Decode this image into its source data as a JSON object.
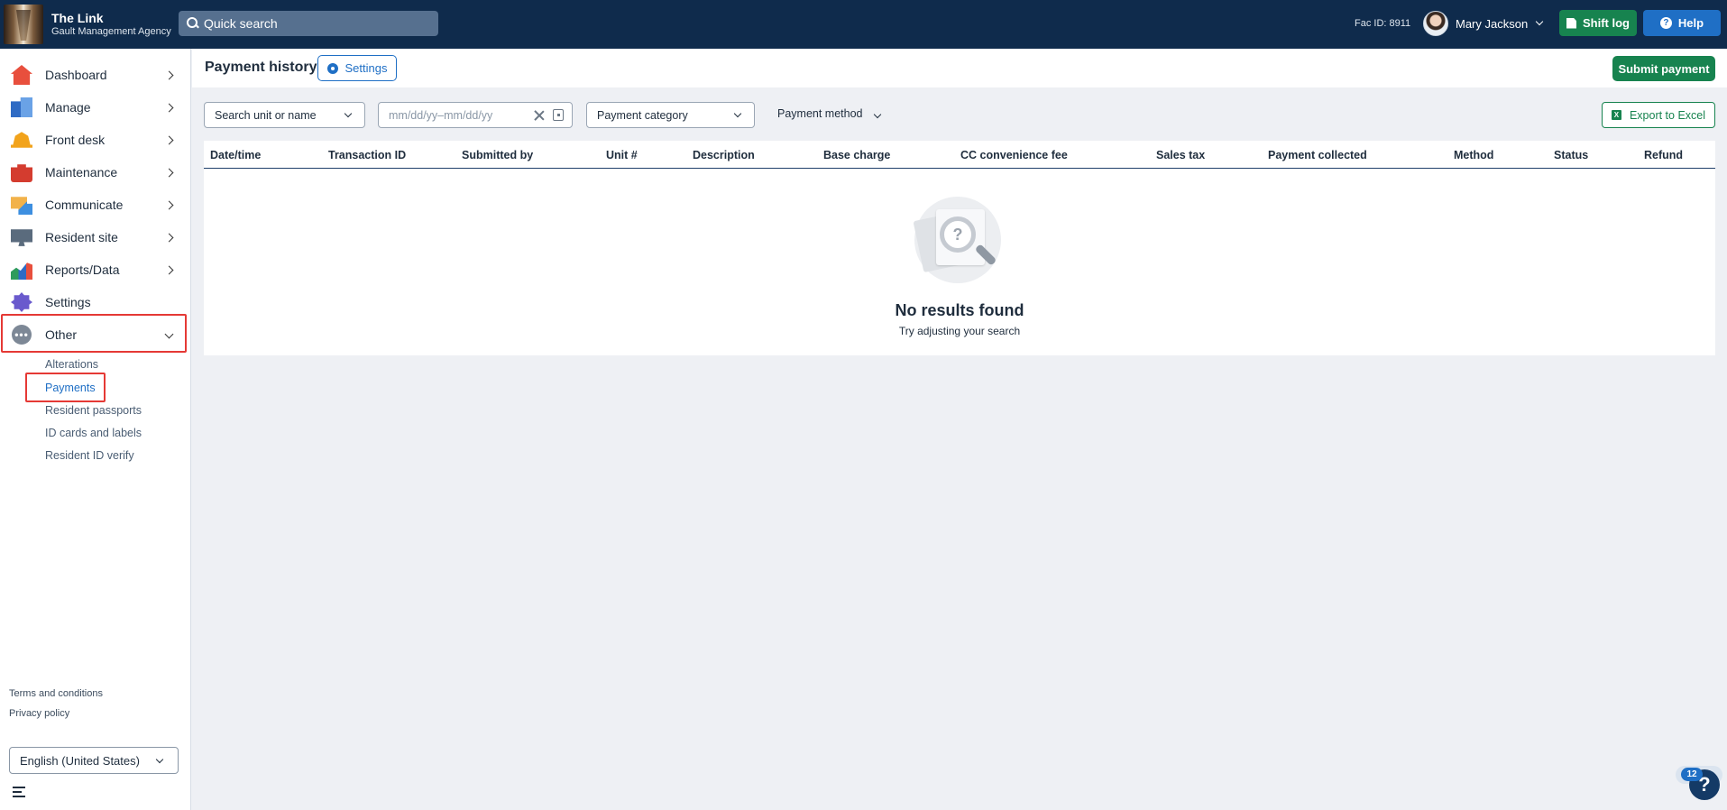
{
  "app": {
    "name": "The Link",
    "agency": "Gault Management Agency",
    "quick_search_label": "Quick search",
    "fac_id": "Fac ID: 8911",
    "user_name": "Mary Jackson",
    "shift_log_label": "Shift log",
    "help_label": "Help"
  },
  "sidebar": {
    "items": [
      {
        "label": "Dashboard"
      },
      {
        "label": "Manage"
      },
      {
        "label": "Front desk"
      },
      {
        "label": "Maintenance"
      },
      {
        "label": "Communicate"
      },
      {
        "label": "Resident site"
      },
      {
        "label": "Reports/Data"
      },
      {
        "label": "Settings"
      },
      {
        "label": "Other"
      }
    ],
    "other_icon_glyph": "•••",
    "sub_items": [
      {
        "label": "Alterations"
      },
      {
        "label": "Payments"
      },
      {
        "label": "Resident passports"
      },
      {
        "label": "ID cards and labels"
      },
      {
        "label": "Resident ID verify"
      }
    ],
    "footer": {
      "terms": "Terms and conditions",
      "privacy": "Privacy policy",
      "language": "English (United States)"
    }
  },
  "page": {
    "title": "Payment history",
    "settings_label": "Settings",
    "submit_label": "Submit payment"
  },
  "filters": {
    "unit_search": "Search unit or name",
    "date_range_placeholder": "mm/dd/yy–mm/dd/yy",
    "category": "Payment category",
    "method": "Payment method",
    "export_label": "Export to Excel",
    "excel_glyph": "X"
  },
  "table": {
    "columns": [
      "Date/time",
      "Transaction ID",
      "Submitted by",
      "Unit #",
      "Description",
      "Base charge",
      "CC convenience fee",
      "Sales tax",
      "Payment collected",
      "Method",
      "Status",
      "Refund"
    ],
    "rows": [],
    "empty_glyph": "?",
    "empty_title": "No results found",
    "empty_subtitle": "Try adjusting your search"
  },
  "help_widget": {
    "badge_count": "12",
    "glyph": "?"
  },
  "colors": {
    "topbar": "#0f2b4c",
    "accent_blue": "#1f6fc5",
    "accent_green": "#17834f",
    "annotation_red": "#e53935"
  }
}
